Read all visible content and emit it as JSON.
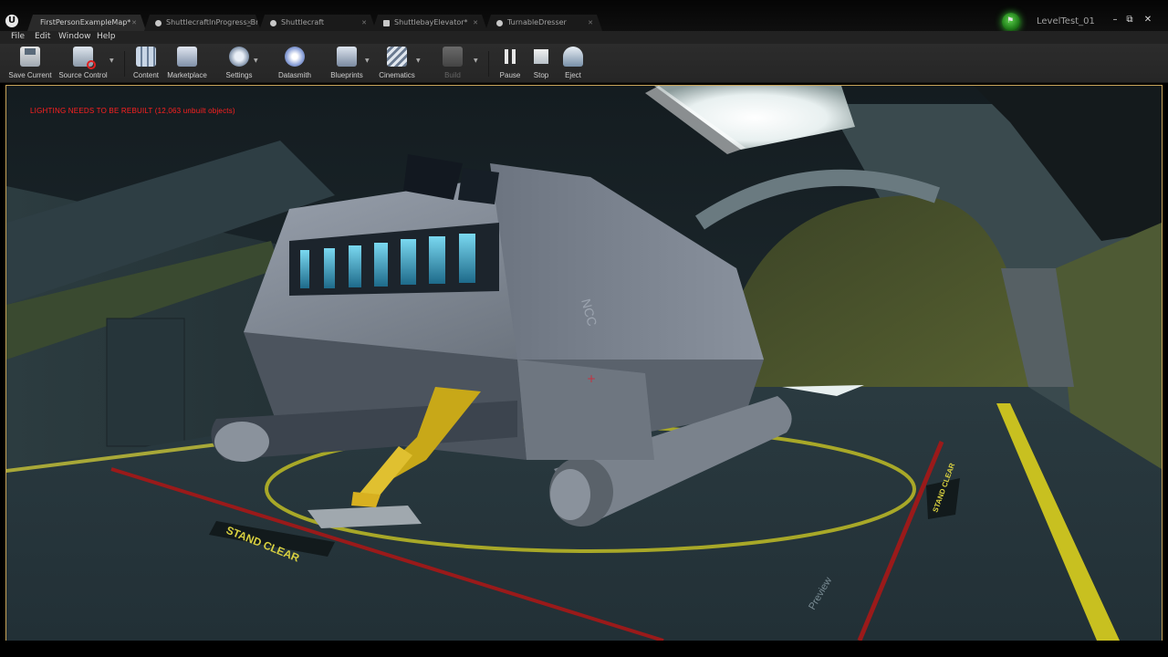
{
  "tabs": [
    {
      "label": "FirstPersonExampleMap*",
      "active": true
    },
    {
      "label": "ShuttlecraftInProgress_Br",
      "active": false
    },
    {
      "label": "Shuttlecraft",
      "active": false
    },
    {
      "label": "ShuttlebayElevator*",
      "active": false
    },
    {
      "label": "TurnableDresser",
      "active": false
    }
  ],
  "level": {
    "name": "LevelTest_01"
  },
  "window_controls": {
    "minimize": "–",
    "restore": "⧉",
    "close": "✕"
  },
  "menu": [
    "File",
    "Edit",
    "Window",
    "Help"
  ],
  "toolbar": {
    "buttons": [
      {
        "label": "Save Current",
        "icon": "save-icon",
        "enabled": true
      },
      {
        "label": "Source Control",
        "icon": "source-control-icon",
        "enabled": true
      },
      {
        "label": "Content",
        "icon": "content-icon",
        "enabled": true
      },
      {
        "label": "Marketplace",
        "icon": "marketplace-icon",
        "enabled": true
      },
      {
        "label": "Settings",
        "icon": "settings-icon",
        "enabled": true
      },
      {
        "label": "Datasmith",
        "icon": "datasmith-icon",
        "enabled": true
      },
      {
        "label": "Blueprints",
        "icon": "blueprints-icon",
        "enabled": true
      },
      {
        "label": "Cinematics",
        "icon": "cinematics-icon",
        "enabled": true
      },
      {
        "label": "Build",
        "icon": "build-icon",
        "enabled": false
      },
      {
        "label": "Pause",
        "icon": "pause-icon",
        "enabled": true
      },
      {
        "label": "Stop",
        "icon": "stop-icon",
        "enabled": true
      },
      {
        "label": "Eject",
        "icon": "eject-icon",
        "enabled": true
      }
    ]
  },
  "viewport": {
    "warning": "LIGHTING NEEDS TO BE REBUILT (12,063 unbuilt objects)",
    "floor_text": {
      "stand_clear": "STAND CLEAR",
      "right_marker": "STAND CLEAR",
      "preview": "Preview"
    },
    "colors": {
      "accent_border": "#c8a45a",
      "floor_yellow": "#c8c020",
      "floor_red": "#9a1a1a",
      "warning_red": "#ff2020"
    }
  }
}
